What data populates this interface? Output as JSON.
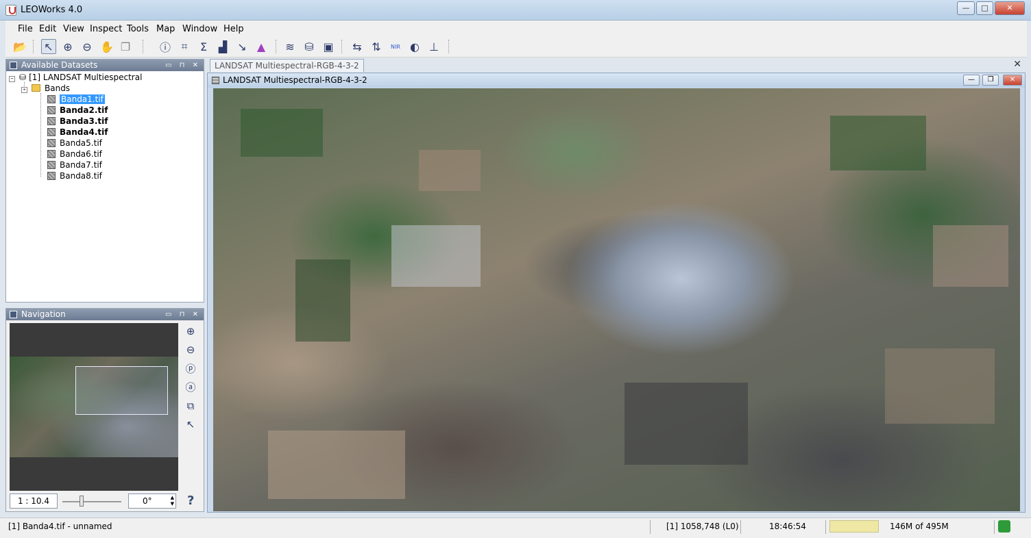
{
  "window": {
    "title": "LEOWorks 4.0",
    "minimize": "—",
    "maximize": "□",
    "close": "✕"
  },
  "menu": [
    "File",
    "Edit",
    "View",
    "Inspect",
    "Tools",
    "Map",
    "Window",
    "Help"
  ],
  "datasets_panel": {
    "title": "Available Datasets",
    "root": "[1] LANDSAT Multiespectral",
    "folder": "Bands",
    "bands": [
      {
        "label": "Banda1.tif",
        "selected": true,
        "bold": false
      },
      {
        "label": "Banda2.tif",
        "selected": false,
        "bold": true
      },
      {
        "label": "Banda3.tif",
        "selected": false,
        "bold": true
      },
      {
        "label": "Banda4.tif",
        "selected": false,
        "bold": true
      },
      {
        "label": "Banda5.tif",
        "selected": false,
        "bold": false
      },
      {
        "label": "Banda6.tif",
        "selected": false,
        "bold": false
      },
      {
        "label": "Banda7.tif",
        "selected": false,
        "bold": false
      },
      {
        "label": "Banda8.tif",
        "selected": false,
        "bold": false
      }
    ]
  },
  "navigation": {
    "title": "Navigation",
    "scale": "1 : 10.4",
    "rotation": "0°",
    "help": "?"
  },
  "document": {
    "tab": "LANDSAT Multiespectral-RGB-4-3-2",
    "frame_title": "LANDSAT Multiespectral-RGB-4-3-2"
  },
  "status": {
    "left": "[1] Banda4.tif - unnamed",
    "coords": "[1] 1058,748 (L0)",
    "time": "18:46:54",
    "memory": "146M of 495M"
  },
  "colors": {
    "selection": "#3399ff",
    "header": "#7a889e"
  }
}
